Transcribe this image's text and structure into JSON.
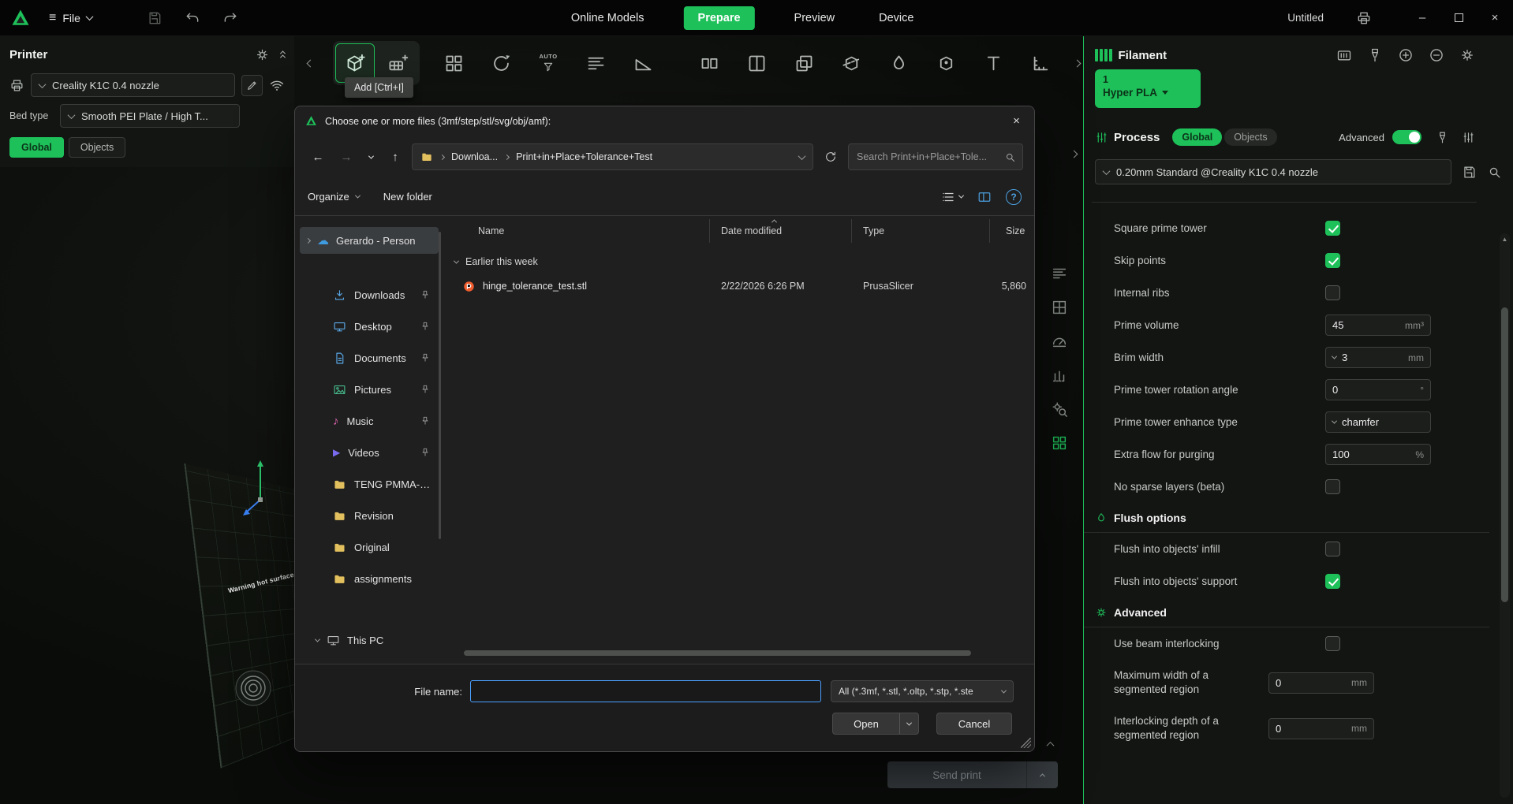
{
  "colors": {
    "accent_green": "#1ec05a",
    "focus_blue": "#4c9fff",
    "folder_yellow": "#e3c05e",
    "onedrive_blue": "#3f9be0",
    "music_pink": "#e066b0",
    "video_purple": "#7a6cf0",
    "prusa_orange": "#ef5b2d"
  },
  "icons": {
    "hamburger": "≡",
    "minimize": "–",
    "close": "×",
    "back": "←",
    "forward": "→",
    "up": "↑",
    "music_note": "♪",
    "play": "▶",
    "cloud": "☁",
    "help": "?",
    "scroll_up": "▲"
  },
  "topbar": {
    "file_menu": "File",
    "tabs": [
      {
        "label": "Online Models",
        "active": false
      },
      {
        "label": "Prepare",
        "active": true
      },
      {
        "label": "Preview",
        "active": false
      },
      {
        "label": "Device",
        "active": false
      }
    ],
    "project_title": "Untitled"
  },
  "toolbar": {
    "tooltip": "Add [Ctrl+I]",
    "auto_label": "AUTO"
  },
  "printer": {
    "title": "Printer",
    "preset": "Creality K1C 0.4 nozzle",
    "bed_type_label": "Bed type",
    "bed_type": "Smooth PEI Plate / High T...",
    "tab_global": "Global",
    "tab_objects": "Objects"
  },
  "viewport": {
    "plate_warning": "Warning hot surface"
  },
  "dlg": {
    "title": "Choose one or more files (3mf/step/stl/svg/obj/amf):",
    "crumb_root": "Downloa...",
    "crumb_folder": "Print+in+Place+Tolerance+Test",
    "search_placeholder": "Search Print+in+Place+Tole...",
    "organize": "Organize",
    "new_folder": "New folder",
    "side": {
      "onedrive": "Gerardo - Person",
      "items": [
        {
          "label": "Downloads",
          "pinned": true
        },
        {
          "label": "Desktop",
          "pinned": true
        },
        {
          "label": "Documents",
          "pinned": true
        },
        {
          "label": "Pictures",
          "pinned": true
        },
        {
          "label": "Music",
          "pinned": true
        },
        {
          "label": "Videos",
          "pinned": true
        },
        {
          "label": "TENG PMMA-Hu",
          "pinned": false
        },
        {
          "label": "Revision",
          "pinned": false
        },
        {
          "label": "Original",
          "pinned": false
        },
        {
          "label": "assignments",
          "pinned": false
        }
      ],
      "this_pc": "This PC"
    },
    "cols": {
      "name": "Name",
      "date": "Date modified",
      "type": "Type",
      "size": "Size"
    },
    "group": "Earlier this week",
    "files": [
      {
        "name": "hinge_tolerance_test.stl",
        "date": "2/22/2026 6:26 PM",
        "type": "PrusaSlicer",
        "size": "5,860"
      }
    ],
    "file_name_label": "File name:",
    "file_name_value": "",
    "file_type": "All (*.3mf, *.stl, *.oltp, *.stp, *.ste",
    "open": "Open",
    "cancel": "Cancel"
  },
  "rp": {
    "filament": {
      "title": "Filament",
      "slot_number": "1",
      "slot_name": "Hyper PLA"
    },
    "process": {
      "title": "Process",
      "scope_global": "Global",
      "scope_objects": "Objects",
      "advanced_label": "Advanced",
      "preset": "0.20mm Standard @Creality K1C 0.4 nozzle",
      "settings": [
        {
          "label": "Square prime tower",
          "type": "checkbox",
          "checked": true
        },
        {
          "label": "Skip points",
          "type": "checkbox",
          "checked": true
        },
        {
          "label": "Internal ribs",
          "type": "checkbox",
          "checked": false
        },
        {
          "label": "Prime volume",
          "type": "input",
          "value": "45",
          "unit": "mm³"
        },
        {
          "label": "Brim width",
          "type": "select",
          "value": "3",
          "unit": "mm"
        },
        {
          "label": "Prime tower rotation angle",
          "type": "input",
          "value": "0",
          "unit": "°"
        },
        {
          "label": "Prime tower enhance type",
          "type": "select",
          "value": "chamfer",
          "unit": ""
        },
        {
          "label": "Extra flow for purging",
          "type": "input",
          "value": "100",
          "unit": "%"
        },
        {
          "label": "No sparse layers (beta)",
          "type": "checkbox",
          "checked": false
        },
        {
          "label": "Flush options",
          "type": "section"
        },
        {
          "label": "Flush into objects' infill",
          "type": "checkbox",
          "checked": false
        },
        {
          "label": "Flush into objects' support",
          "type": "checkbox",
          "checked": true
        },
        {
          "label": "Advanced",
          "type": "section"
        },
        {
          "label": "Use beam interlocking",
          "type": "checkbox",
          "checked": false
        },
        {
          "label": "Maximum width of a segmented region",
          "type": "input",
          "value": "0",
          "unit": "mm"
        },
        {
          "label": "Interlocking depth of a segmented region",
          "type": "input",
          "value": "0",
          "unit": "mm"
        }
      ]
    }
  },
  "footer": {
    "send_print": "Send print"
  }
}
